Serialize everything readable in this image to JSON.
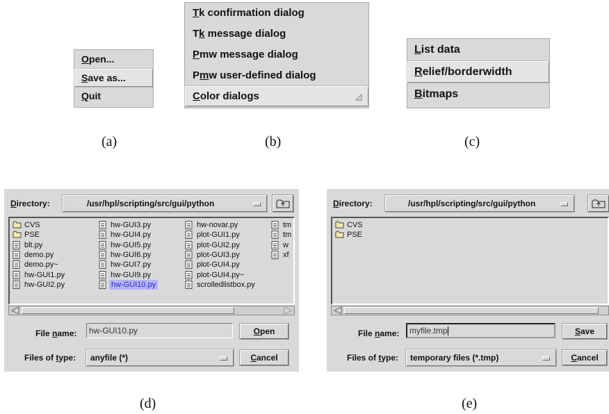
{
  "menu_a": {
    "items": [
      {
        "pre": "",
        "u": "O",
        "post": "pen..."
      },
      {
        "pre": "",
        "u": "S",
        "post": "ave as..."
      },
      {
        "pre": "",
        "u": "Q",
        "post": "uit"
      }
    ],
    "caption": "(a)"
  },
  "menu_b": {
    "items": [
      {
        "pre": "",
        "u": "T",
        "post": "k confirmation dialog"
      },
      {
        "pre": "T",
        "u": "k",
        "post": " message dialog"
      },
      {
        "pre": "",
        "u": "P",
        "post": "mw message dialog"
      },
      {
        "pre": "P",
        "u": "m",
        "post": "w user-defined dialog"
      },
      {
        "pre": "",
        "u": "C",
        "post": "olor dialogs"
      }
    ],
    "caption": "(b)"
  },
  "menu_c": {
    "items": [
      {
        "pre": "",
        "u": "L",
        "post": "ist data"
      },
      {
        "pre": "",
        "u": "R",
        "post": "elief/borderwidth"
      },
      {
        "pre": "",
        "u": "B",
        "post": "itmaps"
      }
    ],
    "caption": "(c)"
  },
  "dialog_d": {
    "directory_label_u": "D",
    "directory_label_rest": "irectory:",
    "directory_value": "/usr/hpl/scripting/src/gui/python",
    "files": [
      [
        "CVS",
        "PSE",
        "blt.py",
        "demo.py",
        "demo.py~",
        "hw-GUI1.py",
        "hw-GUI2.py"
      ],
      [
        "hw-GUI3.py",
        "hw-GUI4.py",
        "hw-GUI5.py",
        "hw-GUI6.py",
        "hw-GUI7.py",
        "hw-GUI9.py",
        "hw-GUI10.py"
      ],
      [
        "hw-novar.py",
        "plot-GUI1.py",
        "plot-GUI2.py",
        "plot-GUI3.py",
        "plot-GUI4.py",
        "plot-GUI4.py~",
        "scrolledlistbox.py"
      ],
      [
        "tm",
        "tm",
        "w",
        "xf"
      ]
    ],
    "folders": [
      "CVS",
      "PSE"
    ],
    "selected": "hw-GUI10.py",
    "filename_label_pre": "File ",
    "filename_label_u": "n",
    "filename_label_post": "ame:",
    "filename_value": "hw-GUI10.py",
    "open_u": "O",
    "open_rest": "pen",
    "type_label_pre": "Files of ",
    "type_label_u": "t",
    "type_label_post": "ype:",
    "type_value": "anyfile (*)",
    "cancel_u": "C",
    "cancel_rest": "ancel",
    "caption": "(d)"
  },
  "dialog_e": {
    "directory_label_u": "D",
    "directory_label_rest": "irectory:",
    "directory_value": "/usr/hpl/scripting/src/gui/python",
    "files": [
      "CVS",
      "PSE"
    ],
    "filename_label_pre": "File ",
    "filename_label_u": "n",
    "filename_label_post": "ame:",
    "filename_value": "myfile.tmp",
    "save_u": "S",
    "save_rest": "ave",
    "type_label_pre": "Files of ",
    "type_label_u": "t",
    "type_label_post": "ype:",
    "type_value": "temporary files (*.tmp)",
    "cancel_u": "C",
    "cancel_rest": "ancel",
    "caption": "(e)"
  }
}
